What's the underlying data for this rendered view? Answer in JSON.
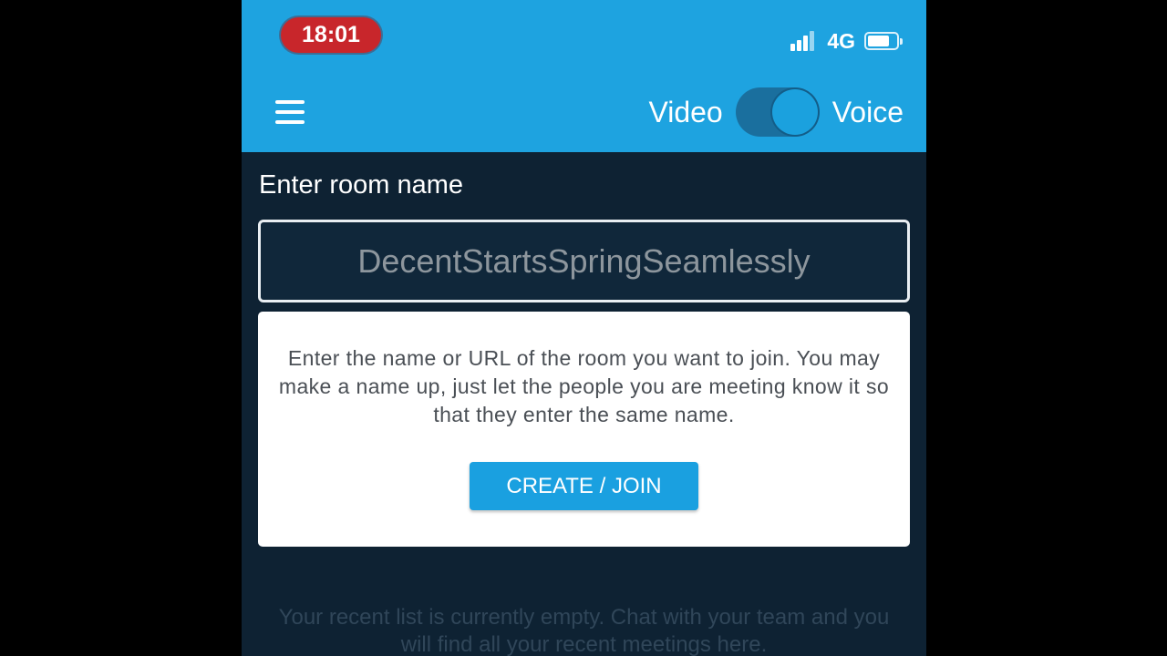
{
  "status_bar": {
    "time": "18:01",
    "network": "4G",
    "icons": [
      "signal-bars-icon",
      "battery-icon"
    ],
    "battery_level": 0.75,
    "time_pill_color": "#c8262b"
  },
  "app_bar": {
    "menu_icon": "hamburger-menu-icon",
    "toggle_left_label": "Video",
    "toggle_right_label": "Voice",
    "toggle_state": "voice",
    "background_color": "#1ea3e0"
  },
  "room": {
    "label": "Enter room name",
    "placeholder": "DecentStartsSpringSeamlessly",
    "value": ""
  },
  "info_card": {
    "text": "Enter the name or URL of the room you want to join. You may make a name up, just let the people you are meeting know it so that they enter the same name.",
    "button_label": "CREATE / JOIN",
    "button_color": "#1aa0e0"
  },
  "recent": {
    "empty_message": "Your recent list is currently empty. Chat with your team and you will find all your recent meetings here."
  },
  "colors": {
    "page_background": "#0e2233",
    "accent": "#1ea3e0"
  }
}
